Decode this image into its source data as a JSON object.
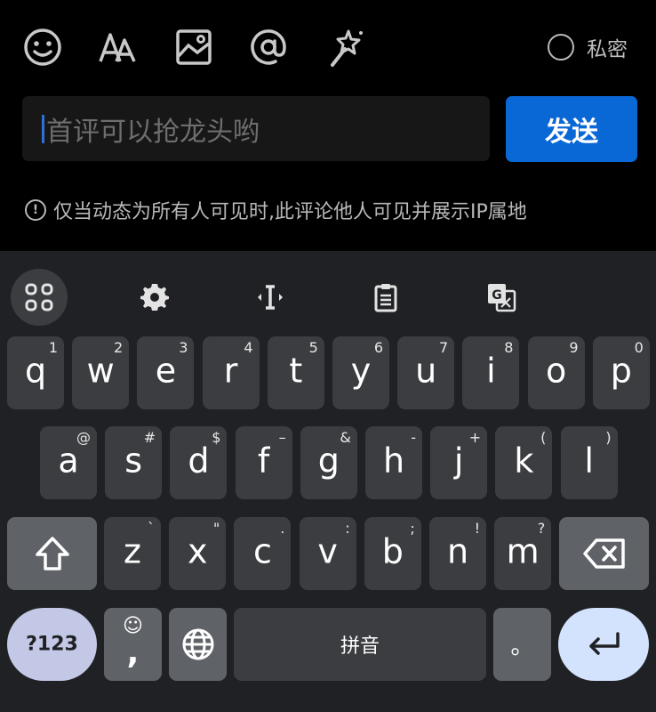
{
  "toolbar": {
    "icons": [
      "emoji-icon",
      "font-size-icon",
      "image-icon",
      "mention-icon",
      "magic-wand-icon"
    ],
    "private_label": "私密"
  },
  "comment": {
    "placeholder": "首评可以抢龙头哟",
    "send_label": "发送",
    "notice_icon": "!",
    "notice": "仅当动态为所有人可见时,此评论他人可见并展示IP属地"
  },
  "keyboard": {
    "toolbar_icons": [
      "apps-grid-icon",
      "settings-gear-icon",
      "text-cursor-icon",
      "clipboard-icon",
      "translate-icon"
    ],
    "row1": [
      {
        "key": "q",
        "hint": "1"
      },
      {
        "key": "w",
        "hint": "2"
      },
      {
        "key": "e",
        "hint": "3"
      },
      {
        "key": "r",
        "hint": "4"
      },
      {
        "key": "t",
        "hint": "5"
      },
      {
        "key": "y",
        "hint": "6"
      },
      {
        "key": "u",
        "hint": "7"
      },
      {
        "key": "i",
        "hint": "8"
      },
      {
        "key": "o",
        "hint": "9"
      },
      {
        "key": "p",
        "hint": "0"
      }
    ],
    "row2": [
      {
        "key": "a",
        "hint": "@"
      },
      {
        "key": "s",
        "hint": "#"
      },
      {
        "key": "d",
        "hint": "$"
      },
      {
        "key": "f",
        "hint": "–"
      },
      {
        "key": "g",
        "hint": "&"
      },
      {
        "key": "h",
        "hint": "-"
      },
      {
        "key": "j",
        "hint": "+"
      },
      {
        "key": "k",
        "hint": "("
      },
      {
        "key": "l",
        "hint": ")"
      }
    ],
    "row3": [
      {
        "key": "z",
        "hint": "`"
      },
      {
        "key": "x",
        "hint": "\""
      },
      {
        "key": "c",
        "hint": "."
      },
      {
        "key": "v",
        "hint": ":"
      },
      {
        "key": "b",
        "hint": ";"
      },
      {
        "key": "n",
        "hint": "!"
      },
      {
        "key": "m",
        "hint": "?"
      }
    ],
    "symbols_label": "?123",
    "comma_label": ",",
    "emoji_hint": "☺",
    "space_label": "拼音",
    "period_label": "。",
    "colors": {
      "background": "#202124",
      "key": "#3c3d40",
      "function_key": "#5f6368",
      "enter": "#d3e3fd",
      "symbols": "#c2c8e6",
      "send": "#0a67d6"
    }
  }
}
